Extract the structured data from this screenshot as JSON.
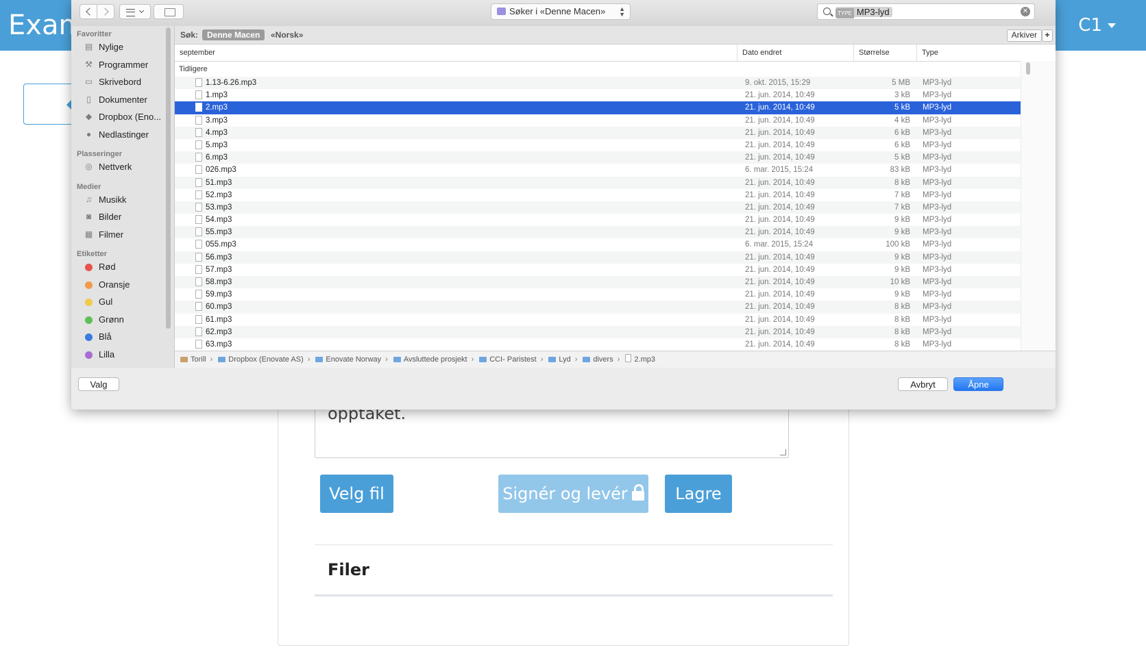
{
  "app": {
    "title": "Exam",
    "user": "C1",
    "answer_text": "opptaket.",
    "buttons": {
      "velg_fil": "Velg fil",
      "sign": "Signér og levér",
      "lagre": "Lagre"
    },
    "files_heading": "Filer",
    "colors": {
      "header": "#4a9fd8",
      "button": "#4a9fd8",
      "button_disabled": "#93c7ea"
    }
  },
  "dialog": {
    "location": "Søker i «Denne Macen»",
    "search": {
      "token_kind": "TYPE",
      "token_value": "MP3-lyd"
    },
    "sidebar": {
      "sections": [
        {
          "title": "Favoritter",
          "items": [
            {
              "label": "Nylige",
              "icon": "recent-icon"
            },
            {
              "label": "Programmer",
              "icon": "applications-icon"
            },
            {
              "label": "Skrivebord",
              "icon": "desktop-icon"
            },
            {
              "label": "Dokumenter",
              "icon": "documents-icon"
            },
            {
              "label": "Dropbox (Eno...",
              "icon": "dropbox-icon"
            },
            {
              "label": "Nedlastinger",
              "icon": "downloads-icon"
            }
          ]
        },
        {
          "title": "Plasseringer",
          "items": [
            {
              "label": "Nettverk",
              "icon": "network-icon"
            }
          ]
        },
        {
          "title": "Medier",
          "items": [
            {
              "label": "Musikk",
              "icon": "music-icon"
            },
            {
              "label": "Bilder",
              "icon": "photos-icon"
            },
            {
              "label": "Filmer",
              "icon": "movies-icon"
            }
          ]
        },
        {
          "title": "Etiketter",
          "items": [
            {
              "label": "Rød",
              "color": "#e5534b"
            },
            {
              "label": "Oransje",
              "color": "#f2994a"
            },
            {
              "label": "Gul",
              "color": "#f2c94c"
            },
            {
              "label": "Grønn",
              "color": "#5fbf55"
            },
            {
              "label": "Blå",
              "color": "#3a7be0"
            },
            {
              "label": "Lilla",
              "color": "#a86cd6"
            }
          ]
        }
      ]
    },
    "scope": {
      "label": "Søk:",
      "this_mac": "Denne Macen",
      "other": "«Norsk»",
      "save": "Arkiver",
      "add": "+"
    },
    "columns": {
      "name": "september",
      "date": "Dato endret",
      "size": "Størrelse",
      "type": "Type"
    },
    "group": "Tidligere",
    "selected_file": "2.mp3",
    "files": [
      {
        "name": "1.13-6.26.mp3",
        "date": "9. okt. 2015, 15:29",
        "size": "5 MB",
        "type": "MP3-lyd"
      },
      {
        "name": "1.mp3",
        "date": "21. jun. 2014, 10:49",
        "size": "3 kB",
        "type": "MP3-lyd"
      },
      {
        "name": "2.mp3",
        "date": "21. jun. 2014, 10:49",
        "size": "5 kB",
        "type": "MP3-lyd"
      },
      {
        "name": "3.mp3",
        "date": "21. jun. 2014, 10:49",
        "size": "4 kB",
        "type": "MP3-lyd"
      },
      {
        "name": "4.mp3",
        "date": "21. jun. 2014, 10:49",
        "size": "6 kB",
        "type": "MP3-lyd"
      },
      {
        "name": "5.mp3",
        "date": "21. jun. 2014, 10:49",
        "size": "6 kB",
        "type": "MP3-lyd"
      },
      {
        "name": "6.mp3",
        "date": "21. jun. 2014, 10:49",
        "size": "5 kB",
        "type": "MP3-lyd"
      },
      {
        "name": "026.mp3",
        "date": "6. mar. 2015, 15:24",
        "size": "83 kB",
        "type": "MP3-lyd"
      },
      {
        "name": "51.mp3",
        "date": "21. jun. 2014, 10:49",
        "size": "8 kB",
        "type": "MP3-lyd"
      },
      {
        "name": "52.mp3",
        "date": "21. jun. 2014, 10:49",
        "size": "7 kB",
        "type": "MP3-lyd"
      },
      {
        "name": "53.mp3",
        "date": "21. jun. 2014, 10:49",
        "size": "7 kB",
        "type": "MP3-lyd"
      },
      {
        "name": "54.mp3",
        "date": "21. jun. 2014, 10:49",
        "size": "9 kB",
        "type": "MP3-lyd"
      },
      {
        "name": "55.mp3",
        "date": "21. jun. 2014, 10:49",
        "size": "9 kB",
        "type": "MP3-lyd"
      },
      {
        "name": "055.mp3",
        "date": "6. mar. 2015, 15:24",
        "size": "100 kB",
        "type": "MP3-lyd"
      },
      {
        "name": "56.mp3",
        "date": "21. jun. 2014, 10:49",
        "size": "9 kB",
        "type": "MP3-lyd"
      },
      {
        "name": "57.mp3",
        "date": "21. jun. 2014, 10:49",
        "size": "9 kB",
        "type": "MP3-lyd"
      },
      {
        "name": "58.mp3",
        "date": "21. jun. 2014, 10:49",
        "size": "10 kB",
        "type": "MP3-lyd"
      },
      {
        "name": "59.mp3",
        "date": "21. jun. 2014, 10:49",
        "size": "9 kB",
        "type": "MP3-lyd"
      },
      {
        "name": "60.mp3",
        "date": "21. jun. 2014, 10:49",
        "size": "8 kB",
        "type": "MP3-lyd"
      },
      {
        "name": "61.mp3",
        "date": "21. jun. 2014, 10:49",
        "size": "8 kB",
        "type": "MP3-lyd"
      },
      {
        "name": "62.mp3",
        "date": "21. jun. 2014, 10:49",
        "size": "8 kB",
        "type": "MP3-lyd"
      },
      {
        "name": "63.mp3",
        "date": "21. jun. 2014, 10:49",
        "size": "8 kB",
        "type": "MP3-lyd"
      }
    ],
    "path": [
      "Torill",
      "Dropbox (Enovate AS)",
      "Enovate Norway",
      "Avsluttede prosjekt",
      "CCI- Paristest",
      "Lyd",
      "divers",
      "2.mp3"
    ],
    "buttons": {
      "options": "Valg",
      "cancel": "Avbryt",
      "open": "Åpne"
    }
  }
}
